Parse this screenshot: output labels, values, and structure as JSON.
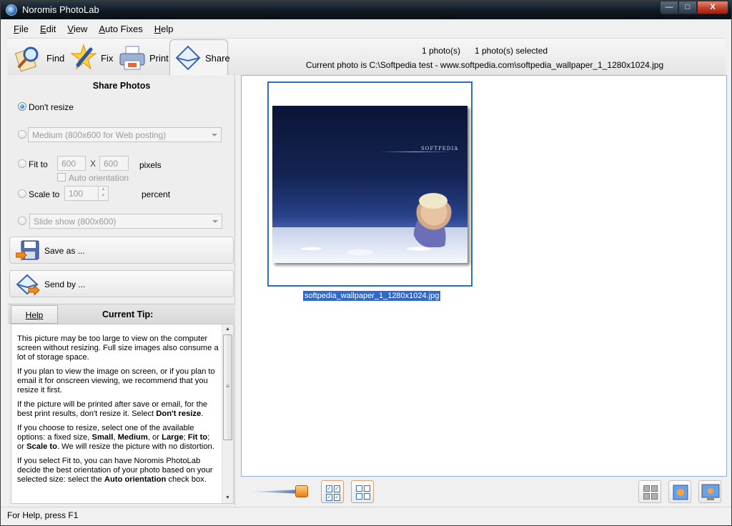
{
  "window": {
    "title": "Noromis PhotoLab",
    "controls": {
      "minimize": "—",
      "maximize": "□",
      "close": "X"
    }
  },
  "menu": [
    {
      "label": "File",
      "accel": "F",
      "rest": "ile"
    },
    {
      "label": "Edit",
      "accel": "E",
      "rest": "dit"
    },
    {
      "label": "View",
      "accel": "V",
      "rest": "iew"
    },
    {
      "label": "Auto Fixes",
      "accel": "A",
      "rest": "uto Fixes"
    },
    {
      "label": "Help",
      "accel": "H",
      "rest": "elp"
    }
  ],
  "tools": {
    "find": "Find",
    "fix": "Fix",
    "print": "Print",
    "share": "Share",
    "active": "Share"
  },
  "info": {
    "photo_count": "1 photo(s)",
    "selected_count": "1 photo(s) selected",
    "current_photo": "Current photo is  C:\\Softpedia test - www.softpedia.com\\softpedia_wallpaper_1_1280x1024.jpg"
  },
  "share_panel": {
    "title": "Share Photos",
    "dont_resize": "Don't resize",
    "medium_option": "Medium (800x600 for Web posting)",
    "fit_to": "Fit to",
    "fit_width": "600",
    "fit_x": "X",
    "fit_height": "600",
    "pixels": "pixels",
    "auto_orientation": "Auto orientation",
    "scale_to": "Scale to",
    "scale_value": "100",
    "percent": "percent",
    "slideshow_option": "Slide show (800x600)",
    "save_as": "Save as ...",
    "send_by": "Send by ...",
    "selected_option": "Don't resize"
  },
  "tip": {
    "help_button": "Help",
    "title": "Current Tip:",
    "p1": "This picture may be too large to view on the computer screen without resizing. Full size images also consume a lot of storage space.",
    "p2": "If you plan to view the image on screen, or if you plan to email it for onscreen viewing, we recommend that you resize it first.",
    "p3a": "If the picture will be printed after save or email, for the best print results, don't resize it. Select ",
    "p3b": "Don't resize",
    "p3c": ".",
    "p4a": "If you choose to resize, select one of the available options: a fixed size, ",
    "p4b": "Small",
    "p4c": ", ",
    "p4d": "Medium",
    "p4e": ", or ",
    "p4f": "Large",
    "p4g": "; ",
    "p4h": "Fit to",
    "p4i": "; or ",
    "p4j": "Scale to",
    "p4k": ". We will resize the picture with no distortion.",
    "p5a": "If you select Fit to, you can have Noromis PhotoLab decide the best orientation of your photo based on your selected size: select the ",
    "p5b": "Auto orientation",
    "p5c": " check box."
  },
  "gallery": {
    "items": [
      {
        "filename": "softpedia_wallpaper_1_1280x1024.jpg",
        "selected": true,
        "logo_text": "SOFTPEDIA"
      }
    ]
  },
  "status": {
    "text": "For Help, press F1"
  },
  "colors": {
    "selection": "#3169c6",
    "frame": "#2f6cc4",
    "accent_orange": "#f07a10"
  }
}
